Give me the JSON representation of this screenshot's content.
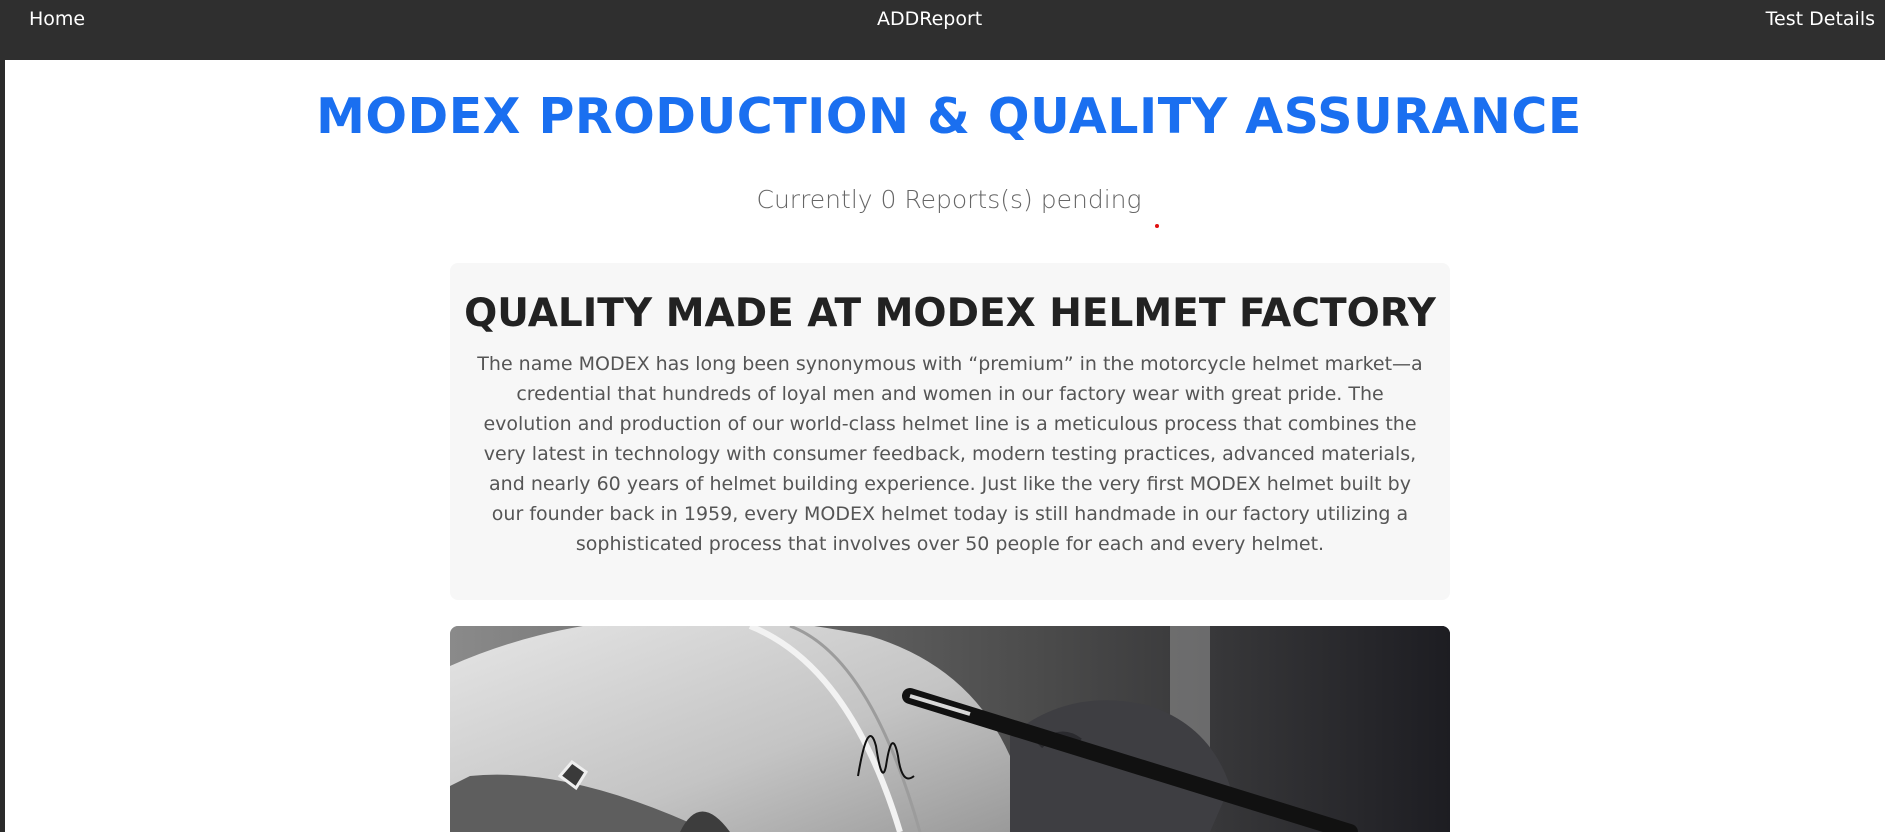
{
  "nav": {
    "home": "Home",
    "add_report": "ADDReport",
    "test_details": "Test Details"
  },
  "header": {
    "title": "MODEX PRODUCTION & QUALITY ASSURANCE",
    "pending": "Currently 0 Reports(s) pending"
  },
  "card": {
    "heading": "QUALITY MADE AT MODEX HELMET FACTORY",
    "body": "The name MODEX has long been synonymous with “premium” in the motorcycle helmet market—a credential that hundreds of loyal men and women in our factory wear with great pride. The evolution and production of our world-class helmet line is a meticulous process that combines the very latest in technology with consumer feedback, modern testing practices, advanced materials, and nearly 60 years of helmet building experience. Just like the very first MODEX helmet built by our founder back in 1959, every MODEX helmet today is still handmade in our factory utilizing a sophisticated process that involves over 50 people for each and every helmet."
  },
  "colors": {
    "navbar": "#2f2f2f",
    "title": "#1a6ff0",
    "card_bg": "#f7f7f7"
  }
}
